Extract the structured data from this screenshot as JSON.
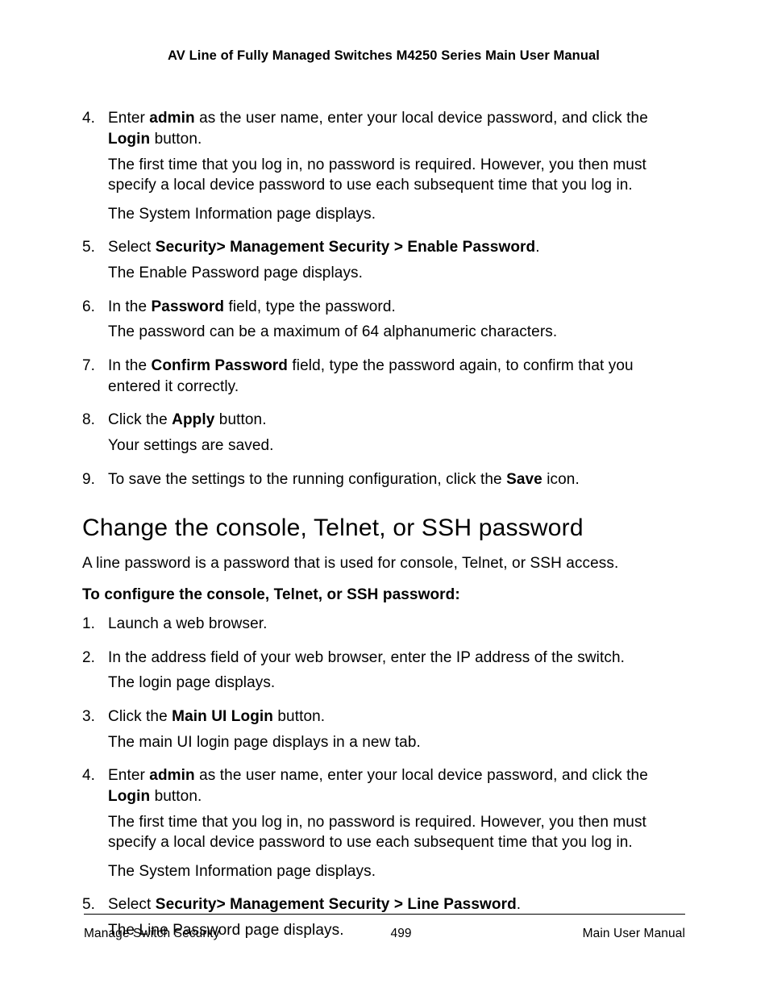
{
  "header": {
    "title": "AV Line of Fully Managed Switches M4250 Series Main User Manual"
  },
  "listA": {
    "items": [
      {
        "num": "4.",
        "runs1": [
          {
            "t": "Enter "
          },
          {
            "t": "admin",
            "b": true
          },
          {
            "t": " as the user name, enter your local device password, and click the "
          },
          {
            "t": "Login",
            "b": true
          },
          {
            "t": " button."
          }
        ],
        "p2": "The first time that you log in, no password is required. However, you then must specify a local device password to use each subsequent time that you log in.",
        "p3": "The System Information page displays."
      },
      {
        "num": "5.",
        "runs1": [
          {
            "t": "Select "
          },
          {
            "t": "Security> Management Security > Enable Password",
            "b": true
          },
          {
            "t": "."
          }
        ],
        "p2": "The Enable Password page displays."
      },
      {
        "num": "6.",
        "runs1": [
          {
            "t": "In the "
          },
          {
            "t": "Password",
            "b": true
          },
          {
            "t": " field, type the password."
          }
        ],
        "p2": "The password can be a maximum of 64 alphanumeric characters."
      },
      {
        "num": "7.",
        "runs1": [
          {
            "t": "In the "
          },
          {
            "t": "Confirm Password",
            "b": true
          },
          {
            "t": " field, type the password again, to confirm that you entered it correctly."
          }
        ]
      },
      {
        "num": "8.",
        "runs1": [
          {
            "t": "Click the "
          },
          {
            "t": "Apply",
            "b": true
          },
          {
            "t": " button."
          }
        ],
        "p2": "Your settings are saved."
      },
      {
        "num": "9.",
        "runs1": [
          {
            "t": "To save the settings to the running configuration, click the "
          },
          {
            "t": "Save",
            "b": true
          },
          {
            "t": " icon."
          }
        ]
      }
    ]
  },
  "section": {
    "heading": "Change the console, Telnet, or SSH password",
    "intro": "A line password is a password that is used for console, Telnet, or SSH access.",
    "subhead": "To configure the console, Telnet, or SSH password:"
  },
  "listB": {
    "items": [
      {
        "num": "1.",
        "runs1": [
          {
            "t": "Launch a web browser."
          }
        ]
      },
      {
        "num": "2.",
        "runs1": [
          {
            "t": "In the address field of your web browser, enter the IP address of the switch."
          }
        ],
        "p2": "The login page displays."
      },
      {
        "num": "3.",
        "runs1": [
          {
            "t": "Click the "
          },
          {
            "t": "Main UI Login",
            "b": true
          },
          {
            "t": " button."
          }
        ],
        "p2": "The main UI login page displays in a new tab."
      },
      {
        "num": "4.",
        "runs1": [
          {
            "t": "Enter "
          },
          {
            "t": "admin",
            "b": true
          },
          {
            "t": " as the user name, enter your local device password, and click the "
          },
          {
            "t": "Login",
            "b": true
          },
          {
            "t": " button."
          }
        ],
        "p2": "The first time that you log in, no password is required. However, you then must specify a local device password to use each subsequent time that you log in.",
        "p3": "The System Information page displays."
      },
      {
        "num": "5.",
        "runs1": [
          {
            "t": "Select "
          },
          {
            "t": "Security> Management Security > Line Password",
            "b": true
          },
          {
            "t": "."
          }
        ],
        "p2": "The Line Password page displays."
      }
    ]
  },
  "footer": {
    "left": "Manage Switch Security",
    "center": "499",
    "right": "Main User Manual"
  }
}
